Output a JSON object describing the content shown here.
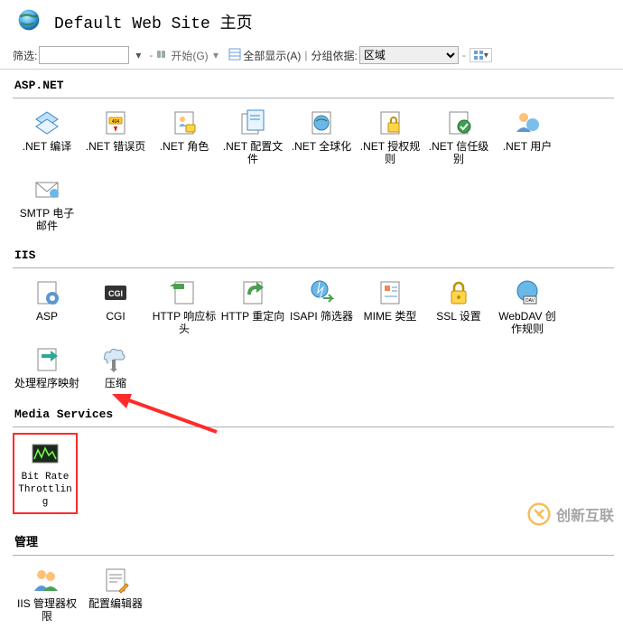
{
  "header": {
    "title": "Default Web Site 主页"
  },
  "toolbar": {
    "filter_label": "筛选:",
    "start_label": "开始(G)",
    "show_all_label": "全部显示(A)",
    "group_by_label": "分组依据:",
    "group_value": "区域"
  },
  "sections": {
    "aspnet": {
      "title": "ASP.NET",
      "items": [
        {
          "label": ".NET 编译"
        },
        {
          "label": ".NET 错误页"
        },
        {
          "label": ".NET 角色"
        },
        {
          "label": ".NET 配置文件"
        },
        {
          "label": ".NET 全球化"
        },
        {
          "label": ".NET 授权规则"
        },
        {
          "label": ".NET 信任级别"
        },
        {
          "label": ".NET 用户"
        },
        {
          "label": "SMTP 电子邮件"
        }
      ]
    },
    "iis": {
      "title": "IIS",
      "items": [
        {
          "label": "ASP"
        },
        {
          "label": "CGI"
        },
        {
          "label": "HTTP 响应标头"
        },
        {
          "label": "HTTP 重定向"
        },
        {
          "label": "ISAPI 筛选器"
        },
        {
          "label": "MIME 类型"
        },
        {
          "label": "SSL 设置"
        },
        {
          "label": "WebDAV 创作规则"
        },
        {
          "label": "处理程序映射"
        },
        {
          "label": "压缩"
        }
      ]
    },
    "media": {
      "title": "Media Services",
      "items": [
        {
          "label": "Bit Rate Throttling"
        }
      ]
    },
    "mgmt": {
      "title": "管理",
      "items": [
        {
          "label": "IIS 管理器权限"
        },
        {
          "label": "配置编辑器"
        }
      ]
    }
  },
  "watermark": {
    "text": "创新互联"
  }
}
